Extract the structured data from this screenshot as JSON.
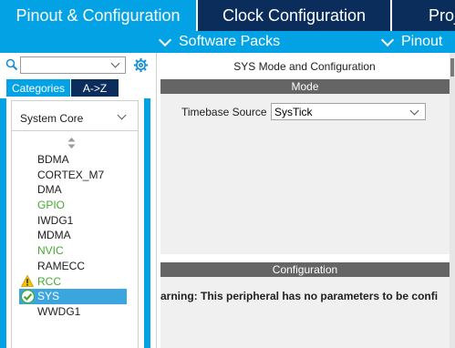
{
  "tabs": [
    {
      "label": "Pinout & Configuration"
    },
    {
      "label": "Clock Configuration"
    },
    {
      "label": "Proj"
    }
  ],
  "subbar": {
    "software_packs": "Software Packs",
    "pinout": "Pinout"
  },
  "search": {
    "value": "",
    "placeholder": ""
  },
  "view_toggle": {
    "categories": "Categories",
    "atoz": "A->Z"
  },
  "category": {
    "label": "System Core"
  },
  "tree": [
    {
      "label": "BDMA",
      "status": "normal"
    },
    {
      "label": "CORTEX_M7",
      "status": "normal"
    },
    {
      "label": "DMA",
      "status": "normal"
    },
    {
      "label": "GPIO",
      "status": "configured"
    },
    {
      "label": "IWDG1",
      "status": "normal"
    },
    {
      "label": "MDMA",
      "status": "normal"
    },
    {
      "label": "NVIC",
      "status": "configured"
    },
    {
      "label": "RAMECC",
      "status": "normal"
    },
    {
      "label": "RCC",
      "status": "warning"
    },
    {
      "label": "SYS",
      "status": "selected"
    },
    {
      "label": "WWDG1",
      "status": "normal"
    }
  ],
  "main": {
    "title": "SYS Mode and Configuration",
    "mode_header": "Mode",
    "timebase_label": "Timebase Source",
    "timebase_value": "SysTick",
    "config_header": "Configuration",
    "warning_text": "arning: This peripheral has no parameters to be confi"
  },
  "colors": {
    "accent": "#03a2e4",
    "dark_tab": "#0b2d5b",
    "header_gray": "#656565",
    "configured_green": "#45a832",
    "warning_yellow": "#f5c400",
    "selected_blue": "#3aa6dd"
  },
  "icons": [
    "search-icon",
    "gear-icon",
    "chevron-down-icon",
    "sort-arrows-icon",
    "warning-icon",
    "check-icon"
  ]
}
